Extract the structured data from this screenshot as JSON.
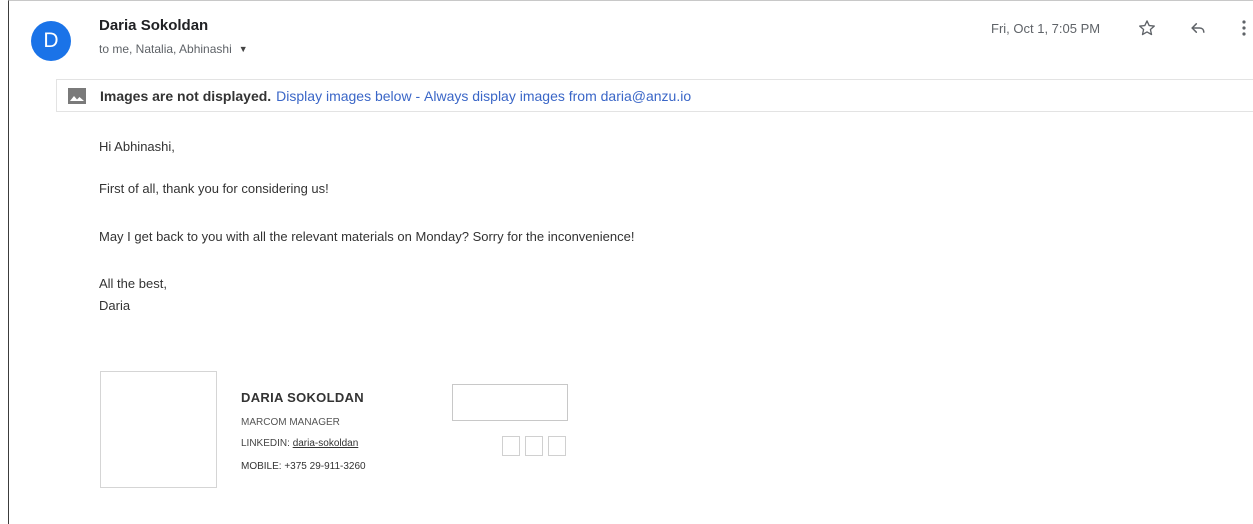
{
  "sender": {
    "avatar_letter": "D",
    "name": "Daria Sokoldan",
    "recipients": "to me, Natalia, Abhinashi",
    "date": "Fri, Oct 1, 7:05 PM"
  },
  "icons": {
    "star": "star-icon",
    "reply": "reply-icon",
    "more": "more-vert-icon",
    "caret": "chevron-down-icon",
    "image": "image-icon"
  },
  "images_banner": {
    "bold": "Images are not displayed.",
    "display_below": "Display images below",
    "separator": " - ",
    "always_display": "Always display images from daria@anzu.io"
  },
  "body": {
    "greeting": "Hi Abhinashi,",
    "line1": "First of all, thank you for considering us!",
    "line2": "May I get back to you with all the relevant materials on Monday? Sorry for the inconvenience!",
    "closing": "All the best,",
    "sign_name": "Daria"
  },
  "signature": {
    "name": "DARIA SOKOLDAN",
    "title": "MARCOM MANAGER",
    "linkedin_label": "LINKEDIN:",
    "linkedin_value": "daria-sokoldan",
    "mobile": "MOBILE: +375 29-911-3260"
  },
  "colors": {
    "avatar": "#1a73e8",
    "link": "#3a66c7"
  }
}
